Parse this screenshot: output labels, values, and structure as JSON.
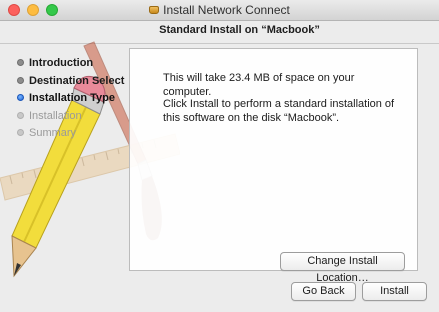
{
  "window": {
    "title": "Install Network Connect",
    "header": "Standard Install on “Macbook”"
  },
  "sidebar": {
    "steps": [
      {
        "label": "Introduction",
        "state": "done"
      },
      {
        "label": "Destination Select",
        "state": "done"
      },
      {
        "label": "Installation Type",
        "state": "current"
      },
      {
        "label": "Installation",
        "state": "future"
      },
      {
        "label": "Summary",
        "state": "future"
      }
    ]
  },
  "main": {
    "space_message": "This will take 23.4 MB of space on your computer.",
    "install_message": "Click Install to perform a standard installation of this software on the disk “Macbook”.",
    "change_location_label": "Change Install Location…"
  },
  "footer": {
    "back_label": "Go Back",
    "install_label": "Install"
  }
}
